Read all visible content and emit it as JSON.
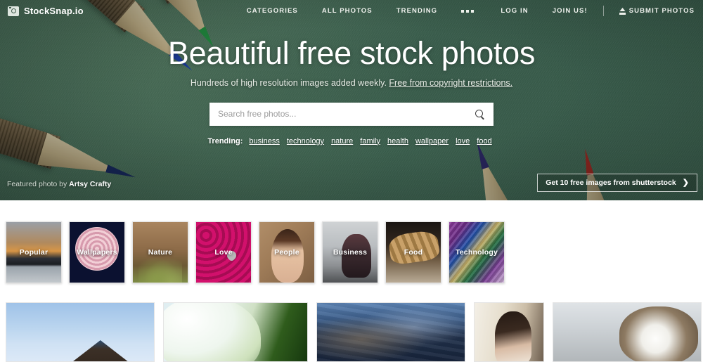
{
  "brand": {
    "name": "StockSnap.io",
    "icon": "camera-icon"
  },
  "nav": {
    "center": [
      {
        "label": "CATEGORIES",
        "name": "nav-categories"
      },
      {
        "label": "ALL PHOTOS",
        "name": "nav-all-photos"
      },
      {
        "label": "TRENDING",
        "name": "nav-trending"
      }
    ],
    "more_icon": "ellipsis-icon",
    "right": [
      {
        "label": "LOG IN",
        "name": "nav-log-in"
      },
      {
        "label": "JOIN US!",
        "name": "nav-join-us"
      }
    ],
    "submit": {
      "label": "SUBMIT PHOTOS",
      "icon": "upload-icon"
    }
  },
  "hero": {
    "title": "Beautiful free stock photos",
    "subtitle_text": "Hundreds of high resolution images added weekly. ",
    "subtitle_link": "Free from copyright restrictions.",
    "featured_prefix": "Featured photo by ",
    "featured_author": "Artsy Crafty",
    "background_color": "#476b57"
  },
  "search": {
    "placeholder": "Search free photos...",
    "value": "",
    "icon": "search-icon"
  },
  "trending": {
    "label": "Trending:",
    "tags": [
      "business",
      "technology",
      "nature",
      "family",
      "health",
      "wallpaper",
      "love",
      "food"
    ]
  },
  "promo": {
    "label": "Get 10 free images from shutterstock",
    "chevron": "❯"
  },
  "categories": [
    {
      "label": "Popular",
      "art": "art-popular"
    },
    {
      "label": "Wallpapers",
      "art": "art-wallpapers"
    },
    {
      "label": "Nature",
      "art": "art-nature"
    },
    {
      "label": "Love",
      "art": "art-love"
    },
    {
      "label": "People",
      "art": "art-people"
    },
    {
      "label": "Business",
      "art": "art-business"
    },
    {
      "label": "Food",
      "art": "art-food"
    },
    {
      "label": "Technology",
      "art": "art-technology"
    }
  ],
  "photos": [
    {
      "alt": "roof-against-blue-sky",
      "cls": "ph-roof"
    },
    {
      "alt": "white-flower-with-dew",
      "cls": "ph-flower"
    },
    {
      "alt": "dark-storm-clouds",
      "cls": "ph-clouds"
    },
    {
      "alt": "woman-by-window",
      "cls": "ph-woman"
    },
    {
      "alt": "tabby-cat-on-bed",
      "cls": "ph-cat"
    }
  ]
}
